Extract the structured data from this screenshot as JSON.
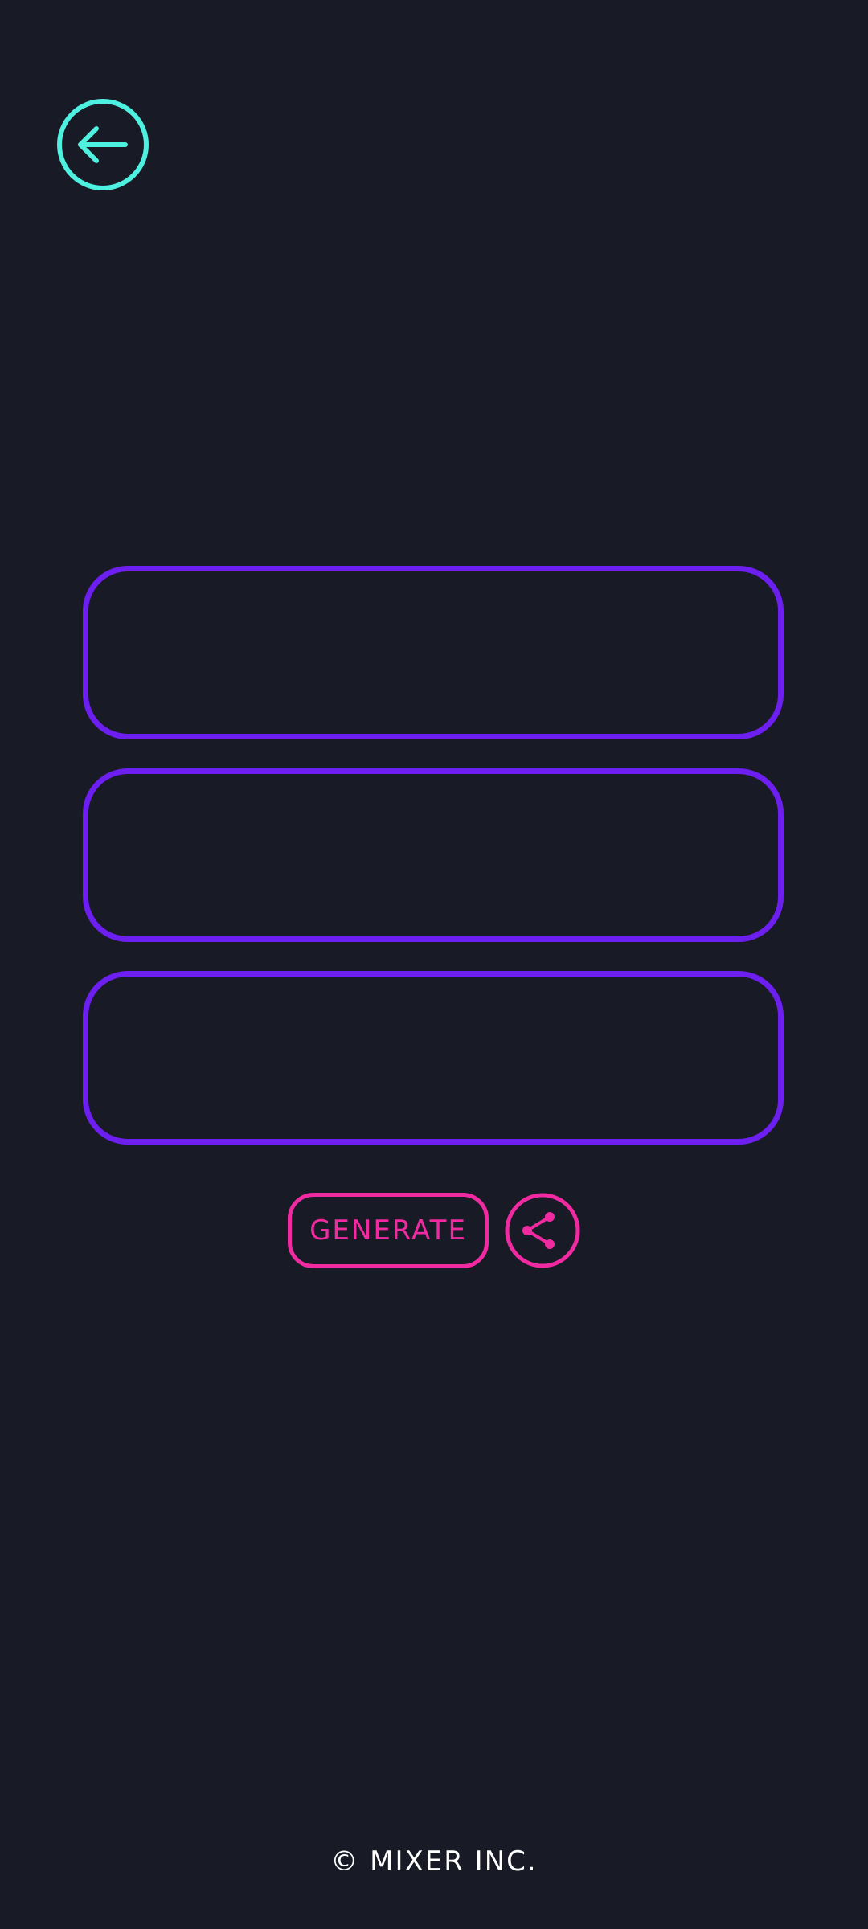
{
  "app": {
    "background_color": "#181a25"
  },
  "header": {
    "back_icon": "arrow-left-circle-icon",
    "back_icon_color": "#4ef0e0"
  },
  "results": {
    "box_border_color": "#6d1ff0",
    "boxes": [
      {
        "text": ""
      },
      {
        "text": ""
      },
      {
        "text": ""
      }
    ]
  },
  "actions": {
    "generate_label": "GENERATE",
    "share_icon": "share-icon",
    "accent_color": "#f02aa0"
  },
  "footer": {
    "copyright": "© MIXER INC."
  }
}
